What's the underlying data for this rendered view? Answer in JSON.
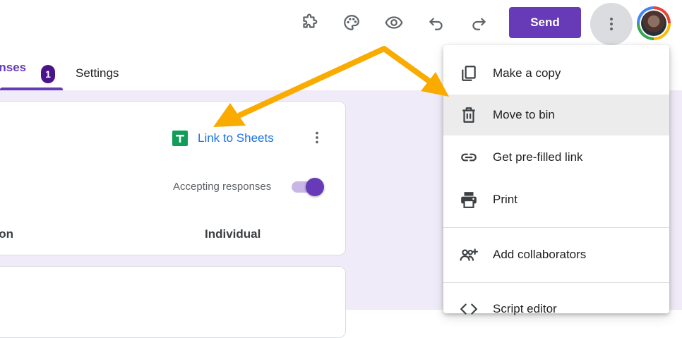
{
  "toolbar": {
    "send_label": "Send",
    "icons": [
      "addon-icon",
      "palette-icon",
      "preview-eye-icon",
      "undo-icon",
      "redo-icon",
      "more-vert-icon"
    ]
  },
  "tabs": {
    "responses_label": "onses",
    "responses_badge": "1",
    "settings_label": "Settings"
  },
  "response_card": {
    "link_label": "Link to Sheets",
    "accepting_label": "Accepting responses",
    "accepting_on": true,
    "subtab_question": "estion",
    "subtab_individual": "Individual"
  },
  "menu": {
    "items": [
      {
        "label": "Make a copy",
        "icon": "copy-icon"
      },
      {
        "label": "Move to bin",
        "icon": "trash-icon"
      },
      {
        "label": "Get pre-filled link",
        "icon": "link-icon"
      },
      {
        "label": "Print",
        "icon": "print-icon"
      },
      {
        "label": "Add collaborators",
        "icon": "add-people-icon"
      },
      {
        "label": "Script editor",
        "icon": "code-icon"
      }
    ]
  },
  "colors": {
    "accent": "#673ab7",
    "arrow": "#f9ab00",
    "link": "#1a73e8",
    "background": "#f0ebf8"
  }
}
